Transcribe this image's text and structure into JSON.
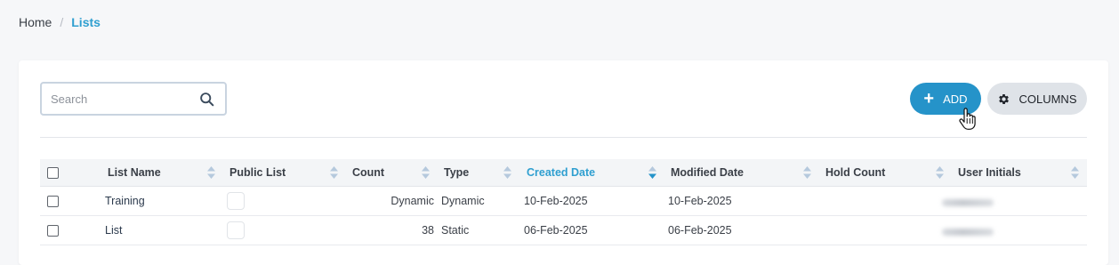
{
  "breadcrumb": {
    "home": "Home",
    "separator": "/",
    "current": "Lists"
  },
  "search": {
    "placeholder": "Search",
    "value": ""
  },
  "toolbar": {
    "add_label": "ADD",
    "columns_label": "COLUMNS"
  },
  "table": {
    "columns": [
      "List Name",
      "Public List",
      "Count",
      "Type",
      "Created Date",
      "Modified Date",
      "Hold Count",
      "User Initials"
    ],
    "sorted_column": "Created Date",
    "sort_direction": "descending",
    "rows": [
      {
        "name": "Training",
        "count": "Dynamic",
        "type": "Dynamic",
        "created": "10-Feb-2025",
        "modified": "10-Feb-2025",
        "hold": ""
      },
      {
        "name": "List",
        "count": "38",
        "type": "Static",
        "created": "06-Feb-2025",
        "modified": "06-Feb-2025",
        "hold": ""
      }
    ]
  },
  "colors": {
    "accent": "#2593c9",
    "link": "#2f9fd0",
    "secondary_button": "#dfe3e8"
  }
}
